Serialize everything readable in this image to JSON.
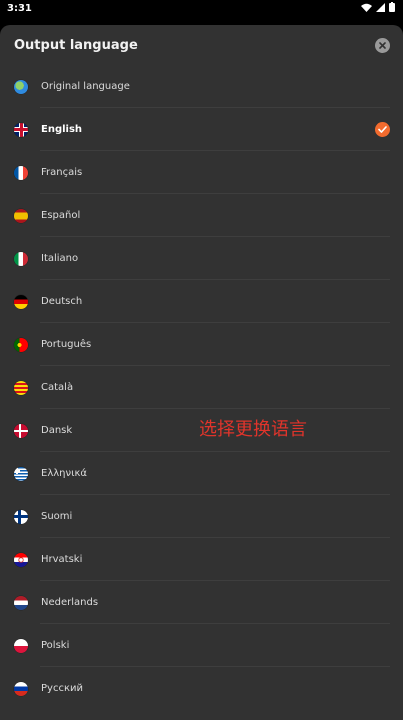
{
  "status_bar": {
    "time": "3:31"
  },
  "sheet": {
    "title": "Output language",
    "close_icon": "close-icon",
    "languages": [
      {
        "label": "Original language",
        "icon": "globe-icon",
        "selected": false
      },
      {
        "label": "English",
        "icon": "uk-flag-icon",
        "selected": true
      },
      {
        "label": "Français",
        "icon": "france-flag-icon",
        "selected": false
      },
      {
        "label": "Español",
        "icon": "spain-flag-icon",
        "selected": false
      },
      {
        "label": "Italiano",
        "icon": "italy-flag-icon",
        "selected": false
      },
      {
        "label": "Deutsch",
        "icon": "germany-flag-icon",
        "selected": false
      },
      {
        "label": "Português",
        "icon": "portugal-flag-icon",
        "selected": false
      },
      {
        "label": "Català",
        "icon": "catalonia-flag-icon",
        "selected": false
      },
      {
        "label": "Dansk",
        "icon": "denmark-flag-icon",
        "selected": false
      },
      {
        "label": "Ελληνικά",
        "icon": "greece-flag-icon",
        "selected": false
      },
      {
        "label": "Suomi",
        "icon": "finland-flag-icon",
        "selected": false
      },
      {
        "label": "Hrvatski",
        "icon": "croatia-flag-icon",
        "selected": false
      },
      {
        "label": "Nederlands",
        "icon": "netherlands-flag-icon",
        "selected": false
      },
      {
        "label": "Polski",
        "icon": "poland-flag-icon",
        "selected": false
      },
      {
        "label": "Русский",
        "icon": "russia-flag-icon",
        "selected": false
      }
    ]
  },
  "annotation": {
    "text": "选择更换语言"
  },
  "colors": {
    "sheet_bg": "#323232",
    "accent": "#f26b2e",
    "annotation": "#e0342b"
  }
}
